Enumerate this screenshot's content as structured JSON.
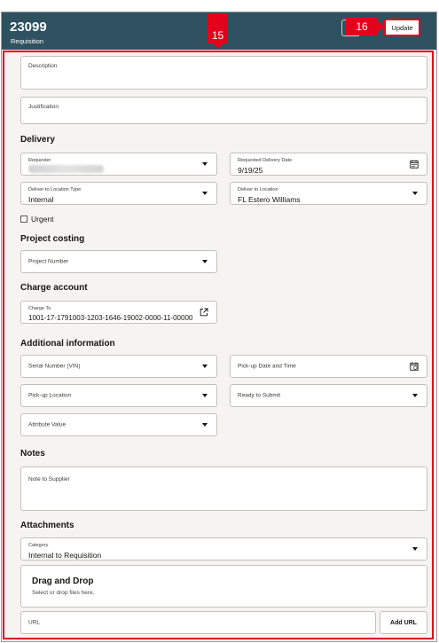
{
  "header": {
    "number": "23099",
    "subtitle": "Requisition",
    "update_label": "Update"
  },
  "callouts": {
    "update_step": "16",
    "form_step": "15"
  },
  "fields": {
    "description": {
      "label": "Description"
    },
    "justification": {
      "label": "Justification"
    },
    "requester": {
      "label": "Requester",
      "value": ""
    },
    "requested_delivery_date": {
      "label": "Requested Delivery Date",
      "value": "9/19/25"
    },
    "deliver_to_location_type": {
      "label": "Deliver-to Location Type",
      "value": "Internal"
    },
    "deliver_to_location": {
      "label": "Deliver to Location",
      "value": "FL Estero Williams"
    },
    "urgent": {
      "label": "Urgent",
      "checked": false
    },
    "project_number": {
      "label": "Project Number"
    },
    "charge_to": {
      "label": "Charge To",
      "value": "1001-17-1791003-1203-1646-19002-0000-11-00000"
    },
    "serial_number": {
      "label": "Serial Number (VIN)"
    },
    "pickup_date_time": {
      "label": "Pick-up Date and Time"
    },
    "pickup_location": {
      "label": "Pick-up Location"
    },
    "ready_to_submit": {
      "label": "Ready to Submit"
    },
    "attribute_value": {
      "label": "Attribute Value"
    },
    "note_to_supplier": {
      "label": "Note to Supplier"
    },
    "category": {
      "label": "Category",
      "value": "Internal to Requisition"
    },
    "url": {
      "placeholder": "URL"
    }
  },
  "sections": {
    "delivery": "Delivery",
    "project_costing": "Project costing",
    "charge_account": "Charge account",
    "additional_information": "Additional information",
    "notes": "Notes",
    "attachments": "Attachments"
  },
  "dragdrop": {
    "title": "Drag and Drop",
    "subtitle": "Select or drop files here."
  },
  "add_url_label": "Add URL",
  "colors": {
    "header_bg": "#2f5160",
    "callout_red": "#e4001b"
  }
}
